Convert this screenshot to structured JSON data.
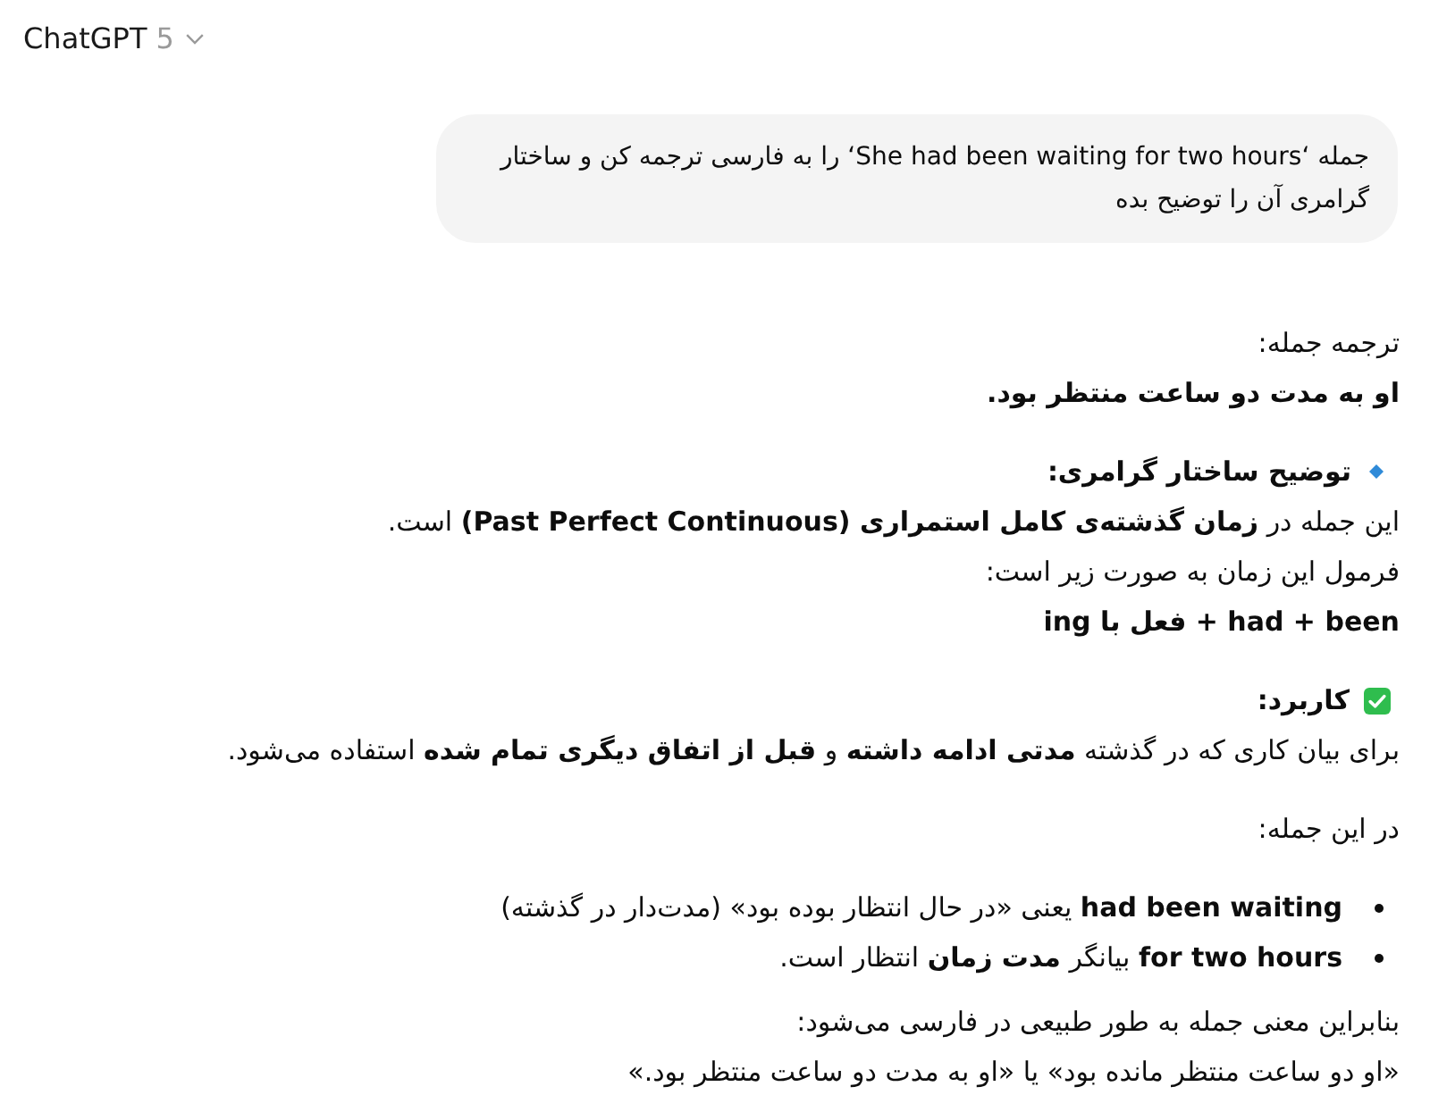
{
  "header": {
    "title": "ChatGPT",
    "version": "5"
  },
  "user_message": {
    "text": "جمله ‘She had been waiting for two hours‘ را به فارسی ترجمه کن و ساختار گرامری آن را توضیح بده"
  },
  "response": {
    "sections": [
      {
        "kind": "paragraphs",
        "lines": [
          {
            "kind": "text",
            "text": "ترجمه جمله:"
          },
          {
            "kind": "bold_text",
            "text": "او به مدت دو ساعت منتظر بود."
          }
        ]
      },
      {
        "kind": "paragraphs",
        "lines": [
          {
            "kind": "diamond_heading",
            "text": "توضیح ساختار گرامری:"
          },
          {
            "kind": "text",
            "text": "این جمله در **زمان گذشته‌ی کامل استمراری (Past Perfect Continuous)** است."
          },
          {
            "kind": "text",
            "text": "فرمول این زمان به صورت زیر است:"
          },
          {
            "kind": "bold_text",
            "text": "had + been + فعل با ing"
          }
        ]
      },
      {
        "kind": "paragraphs",
        "lines": [
          {
            "kind": "check_heading",
            "text": "کاربرد:"
          },
          {
            "kind": "text",
            "text": "برای بیان کاری که در گذشته **مدتی ادامه داشته** و **قبل از اتفاق دیگری تمام شده** استفاده می‌شود."
          }
        ]
      },
      {
        "kind": "paragraphs",
        "lines": [
          {
            "kind": "text",
            "text": "در این جمله:"
          }
        ]
      },
      {
        "kind": "list",
        "lines": [
          {
            "text": "**had been waiting** یعنی «در حال انتظار بوده بود» (مدت‌دار در گذشته)"
          },
          {
            "text": "**for two hours** بیانگر **مدت زمان** انتظار است."
          }
        ]
      },
      {
        "kind": "paragraphs",
        "lines": [
          {
            "kind": "text",
            "text": "بنابراین معنی جمله به طور طبیعی در فارسی می‌شود:"
          },
          {
            "kind": "text",
            "text": "«او دو ساعت منتظر مانده بود» یا «او به مدت دو ساعت منتظر بود.»"
          }
        ]
      }
    ]
  }
}
